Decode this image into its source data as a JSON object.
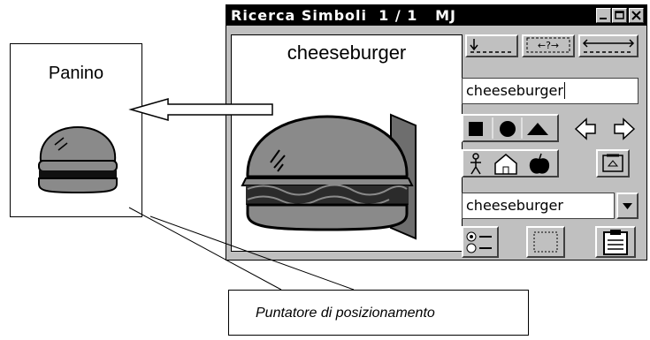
{
  "card": {
    "title": "Panino",
    "image_icon": "sandwich-icon"
  },
  "window": {
    "title": "Ricerca Simboli  1 / 1   MJ",
    "controls": [
      "minimize-icon",
      "maximize-icon",
      "close-icon"
    ],
    "preview_word": "cheeseburger",
    "preview_icon": "cheeseburger-icon",
    "search_value": "cheeseburger",
    "dropdown_value": "cheeseburger",
    "position_labels": {
      "below": "↓",
      "around": "←?→",
      "span": "←→"
    }
  },
  "callout": {
    "text": "Puntatore di posizionamento"
  },
  "colors": {
    "titlebar": "#000000",
    "window_bg": "#c0c0c0",
    "food_gray": "#8a8a8a",
    "accent_arrow": "#c0c0c0"
  }
}
